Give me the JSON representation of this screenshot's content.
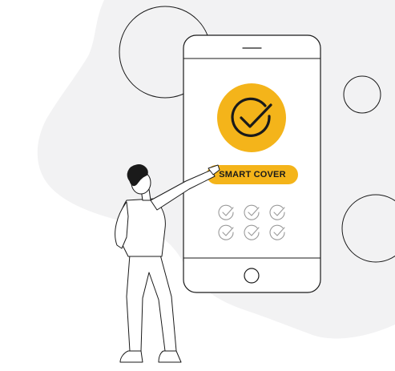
{
  "illustration": {
    "phone_button_label": "SMART COVER",
    "colors": {
      "accent": "#F4B41A",
      "blob": "#F2F2F3",
      "line": "#1a1a1a",
      "check_muted": "#9a9a9a",
      "background": "#ffffff"
    },
    "icons": {
      "hero": "check-circle-icon",
      "list": "check-circle-icon"
    },
    "checklist_rows": 2,
    "checklist_cols": 3
  }
}
